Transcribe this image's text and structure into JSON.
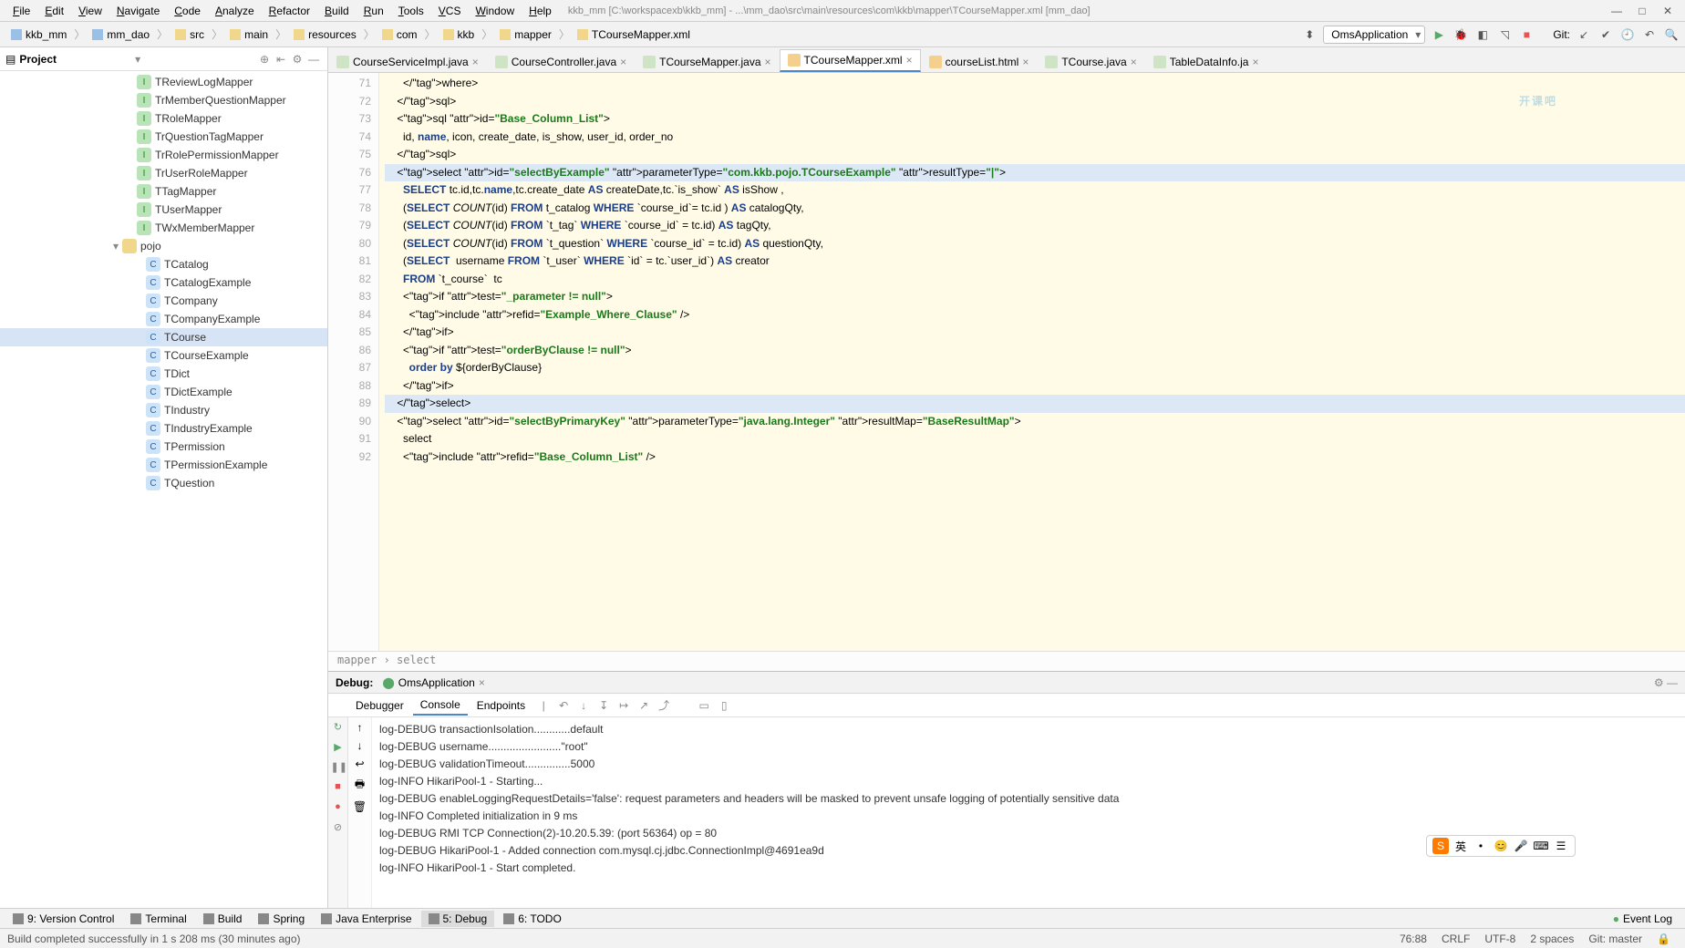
{
  "menu": [
    "File",
    "Edit",
    "View",
    "Navigate",
    "Code",
    "Analyze",
    "Refactor",
    "Build",
    "Run",
    "Tools",
    "VCS",
    "Window",
    "Help"
  ],
  "window_path": "kkb_mm [C:\\workspacexb\\kkb_mm] - ...\\mm_dao\\src\\main\\resources\\com\\kkb\\mapper\\TCourseMapper.xml [mm_dao]",
  "crumbs": [
    "kkb_mm",
    "mm_dao",
    "src",
    "main",
    "resources",
    "com",
    "kkb",
    "mapper",
    "TCourseMapper.xml"
  ],
  "run_config": "OmsApplication",
  "git_label": "Git:",
  "project_label": "Project",
  "tree_items": [
    {
      "icon": "i-interface",
      "label": "TReviewLogMapper"
    },
    {
      "icon": "i-interface",
      "label": "TrMemberQuestionMapper"
    },
    {
      "icon": "i-interface",
      "label": "TRoleMapper"
    },
    {
      "icon": "i-interface",
      "label": "TrQuestionTagMapper"
    },
    {
      "icon": "i-interface",
      "label": "TrRolePermissionMapper"
    },
    {
      "icon": "i-interface",
      "label": "TrUserRoleMapper"
    },
    {
      "icon": "i-interface",
      "label": "TTagMapper"
    },
    {
      "icon": "i-interface",
      "label": "TUserMapper"
    },
    {
      "icon": "i-interface",
      "label": "TWxMemberMapper"
    }
  ],
  "tree_folder": "pojo",
  "tree_pojo": [
    {
      "icon": "i-class",
      "label": "TCatalog"
    },
    {
      "icon": "i-class",
      "label": "TCatalogExample"
    },
    {
      "icon": "i-class",
      "label": "TCompany"
    },
    {
      "icon": "i-class",
      "label": "TCompanyExample"
    },
    {
      "icon": "i-class",
      "label": "TCourse",
      "selected": true
    },
    {
      "icon": "i-class",
      "label": "TCourseExample"
    },
    {
      "icon": "i-class",
      "label": "TDict"
    },
    {
      "icon": "i-class",
      "label": "TDictExample"
    },
    {
      "icon": "i-class",
      "label": "TIndustry"
    },
    {
      "icon": "i-class",
      "label": "TIndustryExample"
    },
    {
      "icon": "i-class",
      "label": "TPermission"
    },
    {
      "icon": "i-class",
      "label": "TPermissionExample"
    },
    {
      "icon": "i-class",
      "label": "TQuestion"
    }
  ],
  "tabs": [
    {
      "label": "CourseServiceImpl.java",
      "icon": "ti-java"
    },
    {
      "label": "CourseController.java",
      "icon": "ti-java"
    },
    {
      "label": "TCourseMapper.java",
      "icon": "ti-java"
    },
    {
      "label": "TCourseMapper.xml",
      "icon": "ti-xml",
      "active": true
    },
    {
      "label": "courseList.html",
      "icon": "ti-html"
    },
    {
      "label": "TCourse.java",
      "icon": "ti-java"
    },
    {
      "label": "TableDataInfo.ja",
      "icon": "ti-java"
    }
  ],
  "line_start": 71,
  "line_end": 92,
  "code_lines": [
    "      </where>",
    "    </sql>",
    "    <sql id=\"Base_Column_List\">",
    "      id, name, icon, create_date, is_show, user_id, order_no",
    "    </sql>",
    "    <select id=\"selectByExample\" parameterType=\"com.kkb.pojo.TCourseExample\" resultType=\"|\">",
    "      SELECT tc.id,tc.name,tc.create_date AS createDate,tc.`is_show` AS isShow ,",
    "      (SELECT COUNT(id) FROM t_catalog WHERE `course_id`= tc.id ) AS catalogQty,",
    "      (SELECT COUNT(id) FROM `t_tag` WHERE `course_id` = tc.id) AS tagQty,",
    "      (SELECT COUNT(id) FROM `t_question` WHERE `course_id` = tc.id) AS questionQty,",
    "      (SELECT  username FROM `t_user` WHERE `id` = tc.`user_id`) AS creator",
    "      FROM `t_course`  tc",
    "      <if test=\"_parameter != null\">",
    "        <include refid=\"Example_Where_Clause\" />",
    "      </if>",
    "      <if test=\"orderByClause != null\">",
    "        order by ${orderByClause}",
    "      </if>",
    "    </select>",
    "    <select id=\"selectByPrimaryKey\" parameterType=\"java.lang.Integer\" resultMap=\"BaseResultMap\">",
    "      select",
    "      <include refid=\"Base_Column_List\" />"
  ],
  "hl_lines": [
    76,
    89
  ],
  "breadcrumb_path": "mapper  ›  select",
  "debug_title": "Debug:",
  "debug_config": "OmsApplication",
  "debug_tabs": [
    "Debugger",
    "Console",
    "Endpoints"
  ],
  "console_lines": [
    "log-DEBUG transactionIsolation............default",
    "log-DEBUG username........................\"root\"",
    "log-DEBUG validationTimeout...............5000",
    "log-INFO HikariPool-1 - Starting...",
    "log-DEBUG enableLoggingRequestDetails='false': request parameters and headers will be masked to prevent unsafe logging of potentially sensitive data",
    "log-INFO Completed initialization in 9 ms",
    "log-DEBUG RMI TCP Connection(2)-10.20.5.39: (port 56364) op = 80",
    "log-DEBUG HikariPool-1 - Added connection com.mysql.cj.jdbc.ConnectionImpl@4691ea9d",
    "log-INFO HikariPool-1 - Start completed."
  ],
  "bottom_tabs": [
    {
      "label": "9: Version Control"
    },
    {
      "label": "Terminal"
    },
    {
      "label": "Build"
    },
    {
      "label": "Spring"
    },
    {
      "label": "Java Enterprise"
    },
    {
      "label": "5: Debug",
      "active": true
    },
    {
      "label": "6: TODO"
    }
  ],
  "event_log_label": "Event Log",
  "status_left": "Build completed successfully in 1 s 208 ms (30 minutes ago)",
  "status_right": [
    "76:88",
    "CRLF",
    "UTF-8",
    "2 spaces",
    "Git: master"
  ],
  "watermark": "开课吧"
}
